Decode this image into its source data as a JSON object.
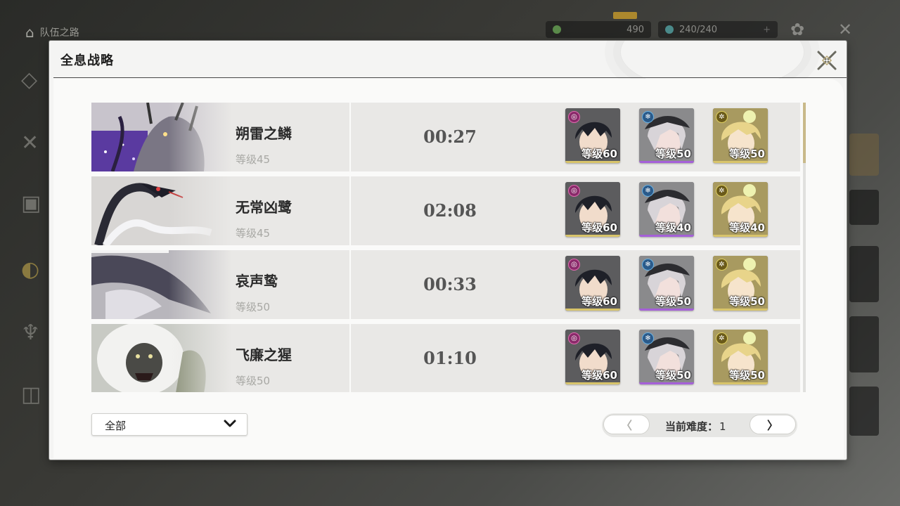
{
  "background": {
    "home_label": "队伍之路",
    "resource_a": "490",
    "resource_b": "240/240"
  },
  "modal": {
    "title": "全息战略"
  },
  "bosses": [
    {
      "name": "朔雷之鳞",
      "level": "等级45",
      "time": "00:27",
      "team": [
        {
          "element": "spectro-swirl",
          "level": "等级60",
          "rarity_color": "#d8c46a"
        },
        {
          "element": "glacio-snowflake",
          "level": "等级50",
          "rarity_color": "#a560d8"
        },
        {
          "element": "sun-gear",
          "level": "等级50",
          "rarity_color": "#d8c46a"
        }
      ]
    },
    {
      "name": "无常凶鹭",
      "level": "等级45",
      "time": "02:08",
      "team": [
        {
          "element": "spectro-swirl",
          "level": "等级60",
          "rarity_color": "#d8c46a"
        },
        {
          "element": "glacio-snowflake",
          "level": "等级40",
          "rarity_color": "#a560d8"
        },
        {
          "element": "sun-gear",
          "level": "等级40",
          "rarity_color": "#d8c46a"
        }
      ]
    },
    {
      "name": "哀声鸷",
      "level": "等级50",
      "time": "00:33",
      "team": [
        {
          "element": "spectro-swirl",
          "level": "等级60",
          "rarity_color": "#d8c46a"
        },
        {
          "element": "glacio-snowflake",
          "level": "等级50",
          "rarity_color": "#a560d8"
        },
        {
          "element": "sun-gear",
          "level": "等级50",
          "rarity_color": "#d8c46a"
        }
      ]
    },
    {
      "name": "飞廉之猩",
      "level": "等级50",
      "time": "01:10",
      "team": [
        {
          "element": "spectro-swirl",
          "level": "等级60",
          "rarity_color": "#d8c46a"
        },
        {
          "element": "glacio-snowflake",
          "level": "等级50",
          "rarity_color": "#a560d8"
        },
        {
          "element": "sun-gear",
          "level": "等级50",
          "rarity_color": "#d8c46a"
        }
      ]
    }
  ],
  "filter": {
    "selected": "全部"
  },
  "pager": {
    "prev": "〈",
    "next": "〉",
    "label": "当前难度：",
    "value": "1"
  },
  "colors": {
    "accent_gold": "#c9b98a",
    "purple_rarity": "#a560d8",
    "gold_rarity": "#d8c46a"
  }
}
